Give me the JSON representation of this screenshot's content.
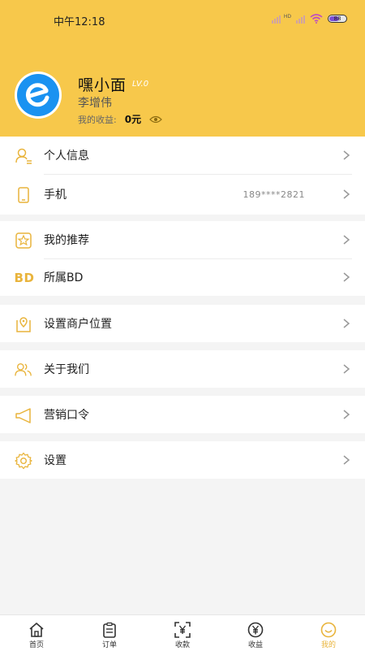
{
  "status_bar": {
    "time": "中午12:18",
    "network": "HD",
    "battery": "88"
  },
  "profile": {
    "name": "嘿小面",
    "level": "LV.0",
    "real_name": "李增伟",
    "earnings_label": "我的收益:",
    "earnings_value": "0元"
  },
  "menu": {
    "personal_info": "个人信息",
    "phone_label": "手机",
    "phone_value": "189****2821",
    "my_referral": "我的推荐",
    "bd_icon": "BD",
    "belonging_bd": "所属BD",
    "set_location": "设置商户位置",
    "about_us": "关于我们",
    "marketing_code": "营销口令",
    "settings": "设置"
  },
  "tabs": [
    {
      "label": "首页",
      "icon": "home-icon"
    },
    {
      "label": "订单",
      "icon": "order-icon"
    },
    {
      "label": "收款",
      "icon": "scan-yen-icon"
    },
    {
      "label": "收益",
      "icon": "yen-coin-icon"
    },
    {
      "label": "我的",
      "icon": "smile-icon"
    }
  ],
  "colors": {
    "header": "#f7c84b",
    "accent": "#e9b43c",
    "avatar": "#1a92f1"
  }
}
